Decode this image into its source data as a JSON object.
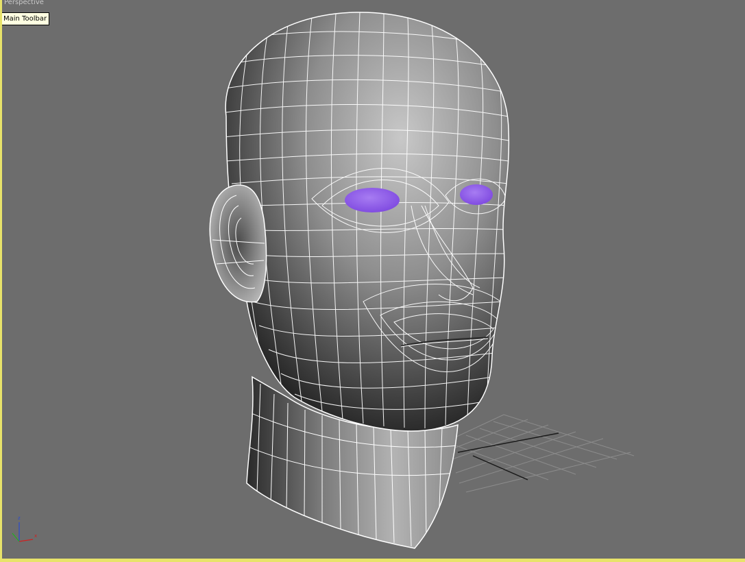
{
  "viewport": {
    "label": "Perspective",
    "background": "#6d6d6d",
    "active_border_color": "#e8e36a"
  },
  "tooltip": {
    "text": "Main Toolbar"
  },
  "axis_gizmo": {
    "z_label": "z",
    "x_label": "x",
    "x_color": "#d02020",
    "z_color": "#2a4bd0",
    "y_color": "#20b020"
  },
  "model": {
    "eye_color": "#8a55e8",
    "wire_color": "#ffffff"
  }
}
